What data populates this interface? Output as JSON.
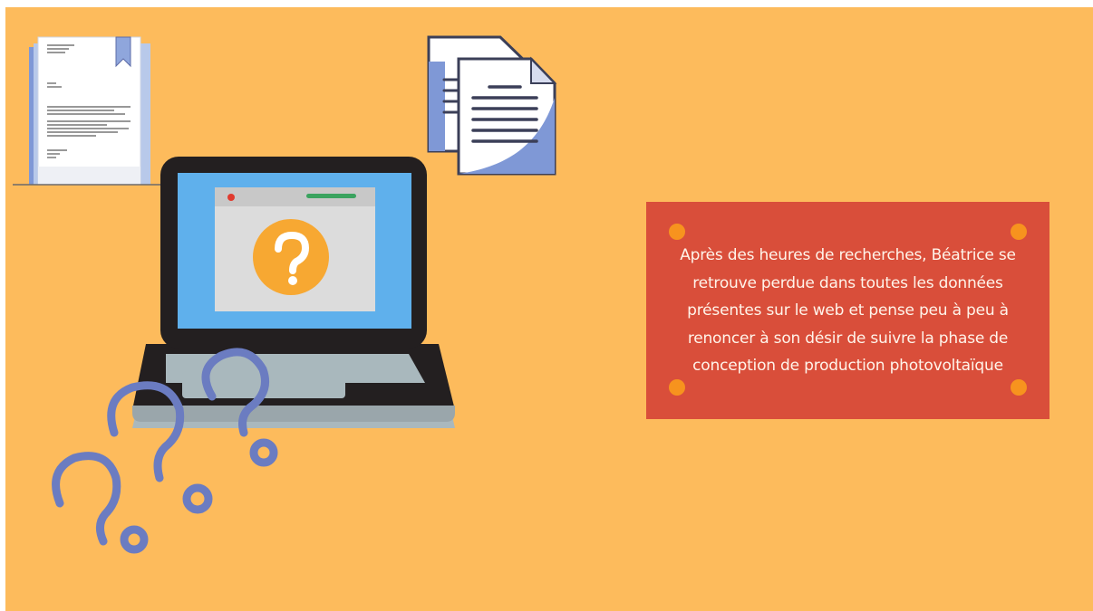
{
  "colors": {
    "background": "#fdbb5c",
    "note_card": "#d94e3a",
    "pins": "#f7931e",
    "note_text": "#fff4ea",
    "laptop_screen": "#5fb0ec",
    "question_badge": "#f7a832",
    "question_marks": "#6b7cc1"
  },
  "icons": [
    "document-icon",
    "copy-files-icon",
    "laptop-icon",
    "question-marks-icon"
  ],
  "note": {
    "lines": [
      "Après des heures de recherches, Béatrice se",
      "retrouve perdue dans toutes les données",
      "présentes sur le web et pense peu à peu à",
      "renoncer à son désir de suivre la phase de",
      "conception de production photovoltaïque"
    ]
  }
}
